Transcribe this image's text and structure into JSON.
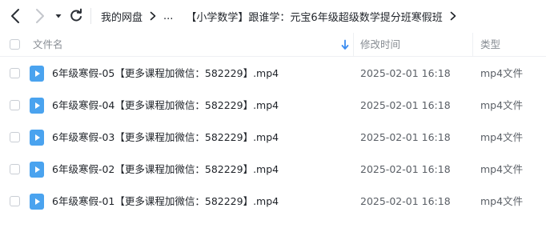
{
  "toolbar": {
    "breadcrumbs": [
      "我的网盘",
      "...",
      "【小学数学】跟谁学：元宝6年级超级数学提分班寒假班"
    ]
  },
  "header": {
    "name_label": "文件名",
    "date_label": "修改时间",
    "type_label": "类型"
  },
  "files": [
    {
      "name": "6年级寒假-05【更多课程加微信：582229】.mp4",
      "modified": "2025-02-01 16:18",
      "type": "mp4文件"
    },
    {
      "name": "6年级寒假-04【更多课程加微信：582229】.mp4",
      "modified": "2025-02-01 16:18",
      "type": "mp4文件"
    },
    {
      "name": "6年级寒假-03【更多课程加微信：582229】.mp4",
      "modified": "2025-02-01 16:18",
      "type": "mp4文件"
    },
    {
      "name": "6年级寒假-02【更多课程加微信：582229】.mp4",
      "modified": "2025-02-01 16:18",
      "type": "mp4文件"
    },
    {
      "name": "6年级寒假-01【更多课程加微信：582229】.mp4",
      "modified": "2025-02-01 16:18",
      "type": "mp4文件"
    }
  ],
  "colors": {
    "video_icon": "#4aa3ef",
    "sort_icon": "#3b8cf0"
  }
}
